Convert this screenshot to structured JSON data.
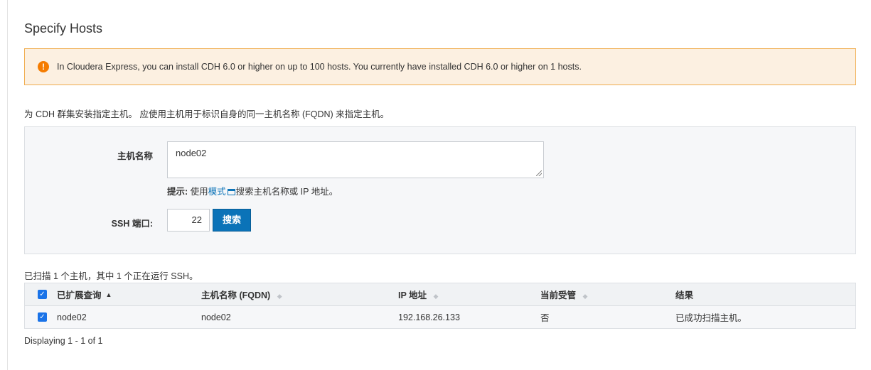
{
  "page": {
    "title": "Specify Hosts"
  },
  "alert": {
    "icon": "exclamation-icon",
    "text": "In Cloudera Express, you can install CDH 6.0 or higher on up to 100 hosts. You currently have installed CDH 6.0 or higher on 1 hosts.",
    "colors": {
      "background": "#fcf0e1",
      "border": "#f0ad4e",
      "icon": "#f57c00"
    }
  },
  "intro": "为 CDH 群集安装指定主机。 应使用主机用于标识自身的同一主机名称 (FQDN) 来指定主机。",
  "form": {
    "hostname_label": "主机名称",
    "hostname_value": "node02",
    "hint_prefix": "提示:",
    "hint_use": " 使用",
    "hint_link": "模式",
    "hint_icon": "window-icon",
    "hint_suffix": "搜索主机名称或 IP 地址。",
    "ssh_port_label": "SSH 端口:",
    "ssh_port_value": "22",
    "search_button": "搜索"
  },
  "scan_summary": "已扫描 1 个主机，其中 1 个正在运行 SSH。",
  "table": {
    "columns": [
      {
        "label": "已扩展查询",
        "sort": "asc"
      },
      {
        "label": "主机名称 (FQDN)",
        "sort": "none"
      },
      {
        "label": "IP 地址",
        "sort": "none"
      },
      {
        "label": "当前受管",
        "sort": "none"
      },
      {
        "label": "结果",
        "sort": ""
      }
    ],
    "rows": [
      {
        "checked": true,
        "expanded_query": "node02",
        "fqdn": "node02",
        "ip": "192.168.26.133",
        "managed": "否",
        "result": "已成功扫描主机。"
      }
    ]
  },
  "footer": "Displaying 1 - 1 of 1",
  "colors": {
    "accent": "#0b73b8",
    "checkbox": "#1a73e8"
  }
}
